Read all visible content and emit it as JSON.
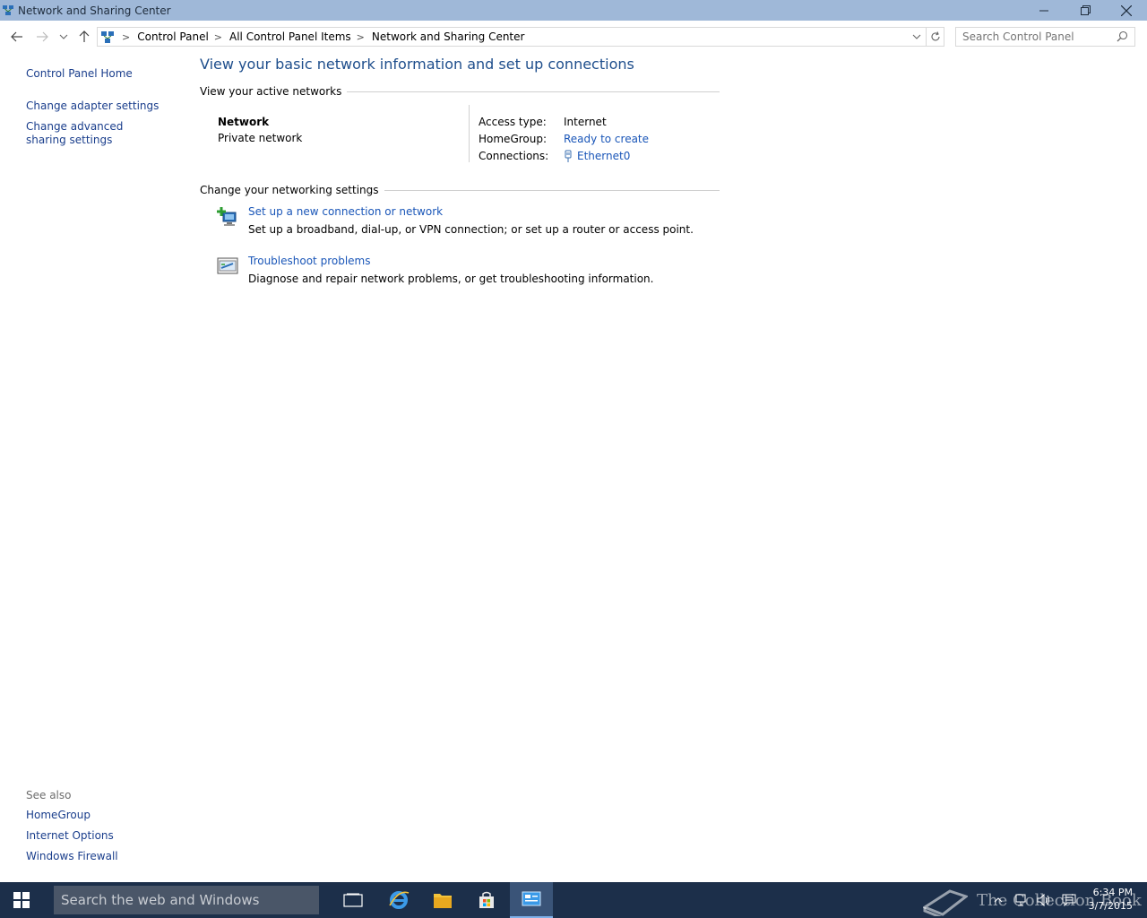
{
  "window": {
    "title": "Network and Sharing Center"
  },
  "address": {
    "crumbs": [
      "Control Panel",
      "All Control Panel Items",
      "Network and Sharing Center"
    ]
  },
  "search": {
    "placeholder": "Search Control Panel"
  },
  "sidebar": {
    "items": [
      {
        "label": "Control Panel Home"
      },
      {
        "label": "Change adapter settings"
      },
      {
        "label": "Change advanced sharing settings"
      }
    ],
    "see_also_heading": "See also",
    "see_also": [
      {
        "label": "HomeGroup"
      },
      {
        "label": "Internet Options"
      },
      {
        "label": "Windows Firewall"
      }
    ]
  },
  "main": {
    "title": "View your basic network information and set up connections",
    "active_networks_heading": "View your active networks",
    "network": {
      "name": "Network",
      "type": "Private network",
      "access_type_label": "Access type:",
      "access_type_value": "Internet",
      "homegroup_label": "HomeGroup:",
      "homegroup_value": "Ready to create",
      "connections_label": "Connections:",
      "connections_value": "Ethernet0"
    },
    "change_settings_heading": "Change your networking settings",
    "tasks": [
      {
        "link": "Set up a new connection or network",
        "description": "Set up a broadband, dial-up, or VPN connection; or set up a router or access point."
      },
      {
        "link": "Troubleshoot problems",
        "description": "Diagnose and repair network problems, or get troubleshooting information."
      }
    ]
  },
  "taskbar": {
    "search_placeholder": "Search the web and Windows",
    "watermark": "The Collection Book",
    "time": "6:34 PM",
    "date": "3/7/2015"
  },
  "colors": {
    "titlebar": "#9fb8d8",
    "link": "#1a56b8",
    "title_text": "#1e4e8c",
    "taskbar": "#1c2f4a"
  }
}
